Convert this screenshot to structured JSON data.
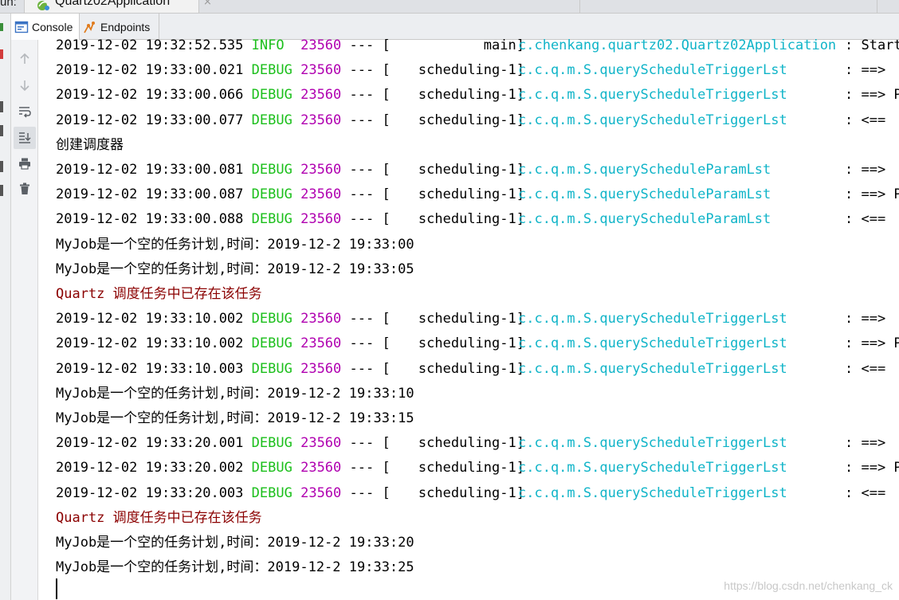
{
  "run_bar": {
    "label": "un:",
    "tab_title": "Quartz02Application",
    "close_glyph": "×"
  },
  "tabs": [
    {
      "label": "Console",
      "icon": "console-icon",
      "active": true
    },
    {
      "label": "Endpoints",
      "icon": "endpoints-icon",
      "active": false
    }
  ],
  "toolbar": [
    {
      "icon": "arrow-up-icon",
      "pressed": false
    },
    {
      "icon": "arrow-down-icon",
      "pressed": false
    },
    {
      "icon": "soft-wrap-icon",
      "pressed": false
    },
    {
      "icon": "scroll-to-end-icon",
      "pressed": true
    },
    {
      "icon": "print-icon",
      "pressed": false
    },
    {
      "icon": "trash-icon",
      "pressed": false
    }
  ],
  "colors": {
    "debug": "#1bbf1b",
    "pid": "#b000b0",
    "logger": "#10b4c8",
    "error": "#8b0000",
    "text": "#000000"
  },
  "console": {
    "lines": [
      {
        "kind": "log",
        "ts": "2019-12-02 19:32:52.535",
        "level": "INFO",
        "pid": "23560",
        "sep": "---",
        "thread": "main",
        "logger": "c.chenkang.quartz02.Quartz02Application",
        "msg": ": Start"
      },
      {
        "kind": "log",
        "ts": "2019-12-02 19:33:00.021",
        "level": "DEBUG",
        "pid": "23560",
        "sep": "---",
        "thread": "scheduling-1",
        "logger": "c.c.q.m.S.queryScheduleTriggerLst",
        "msg": ": ==>"
      },
      {
        "kind": "log",
        "ts": "2019-12-02 19:33:00.066",
        "level": "DEBUG",
        "pid": "23560",
        "sep": "---",
        "thread": "scheduling-1",
        "logger": "c.c.q.m.S.queryScheduleTriggerLst",
        "msg": ": ==> P"
      },
      {
        "kind": "log",
        "ts": "2019-12-02 19:33:00.077",
        "level": "DEBUG",
        "pid": "23560",
        "sep": "---",
        "thread": "scheduling-1",
        "logger": "c.c.q.m.S.queryScheduleTriggerLst",
        "msg": ": <=="
      },
      {
        "kind": "text",
        "text": "创建调度器"
      },
      {
        "kind": "log",
        "ts": "2019-12-02 19:33:00.081",
        "level": "DEBUG",
        "pid": "23560",
        "sep": "---",
        "thread": "scheduling-1",
        "logger": "c.c.q.m.S.queryScheduleParamLst",
        "msg": ": ==>"
      },
      {
        "kind": "log",
        "ts": "2019-12-02 19:33:00.087",
        "level": "DEBUG",
        "pid": "23560",
        "sep": "---",
        "thread": "scheduling-1",
        "logger": "c.c.q.m.S.queryScheduleParamLst",
        "msg": ": ==> P"
      },
      {
        "kind": "log",
        "ts": "2019-12-02 19:33:00.088",
        "level": "DEBUG",
        "pid": "23560",
        "sep": "---",
        "thread": "scheduling-1",
        "logger": "c.c.q.m.S.queryScheduleParamLst",
        "msg": ": <=="
      },
      {
        "kind": "text",
        "text": "MyJob是一个空的任务计划,时间：2019-12-2 19:33:00"
      },
      {
        "kind": "text",
        "text": "MyJob是一个空的任务计划,时间：2019-12-2 19:33:05"
      },
      {
        "kind": "error",
        "text": "Quartz 调度任务中已存在该任务"
      },
      {
        "kind": "log",
        "ts": "2019-12-02 19:33:10.002",
        "level": "DEBUG",
        "pid": "23560",
        "sep": "---",
        "thread": "scheduling-1",
        "logger": "c.c.q.m.S.queryScheduleTriggerLst",
        "msg": ": ==>"
      },
      {
        "kind": "log",
        "ts": "2019-12-02 19:33:10.002",
        "level": "DEBUG",
        "pid": "23560",
        "sep": "---",
        "thread": "scheduling-1",
        "logger": "c.c.q.m.S.queryScheduleTriggerLst",
        "msg": ": ==> P"
      },
      {
        "kind": "log",
        "ts": "2019-12-02 19:33:10.003",
        "level": "DEBUG",
        "pid": "23560",
        "sep": "---",
        "thread": "scheduling-1",
        "logger": "c.c.q.m.S.queryScheduleTriggerLst",
        "msg": ": <=="
      },
      {
        "kind": "text",
        "text": "MyJob是一个空的任务计划,时间：2019-12-2 19:33:10"
      },
      {
        "kind": "text",
        "text": "MyJob是一个空的任务计划,时间：2019-12-2 19:33:15"
      },
      {
        "kind": "log",
        "ts": "2019-12-02 19:33:20.001",
        "level": "DEBUG",
        "pid": "23560",
        "sep": "---",
        "thread": "scheduling-1",
        "logger": "c.c.q.m.S.queryScheduleTriggerLst",
        "msg": ": ==>"
      },
      {
        "kind": "log",
        "ts": "2019-12-02 19:33:20.002",
        "level": "DEBUG",
        "pid": "23560",
        "sep": "---",
        "thread": "scheduling-1",
        "logger": "c.c.q.m.S.queryScheduleTriggerLst",
        "msg": ": ==> P"
      },
      {
        "kind": "log",
        "ts": "2019-12-02 19:33:20.003",
        "level": "DEBUG",
        "pid": "23560",
        "sep": "---",
        "thread": "scheduling-1",
        "logger": "c.c.q.m.S.queryScheduleTriggerLst",
        "msg": ": <=="
      },
      {
        "kind": "error",
        "text": "Quartz 调度任务中已存在该任务"
      },
      {
        "kind": "text",
        "text": "MyJob是一个空的任务计划,时间：2019-12-2 19:33:20"
      },
      {
        "kind": "text",
        "text": "MyJob是一个空的任务计划,时间：2019-12-2 19:33:25"
      }
    ]
  },
  "watermark": "https://blog.csdn.net/chenkang_ck"
}
